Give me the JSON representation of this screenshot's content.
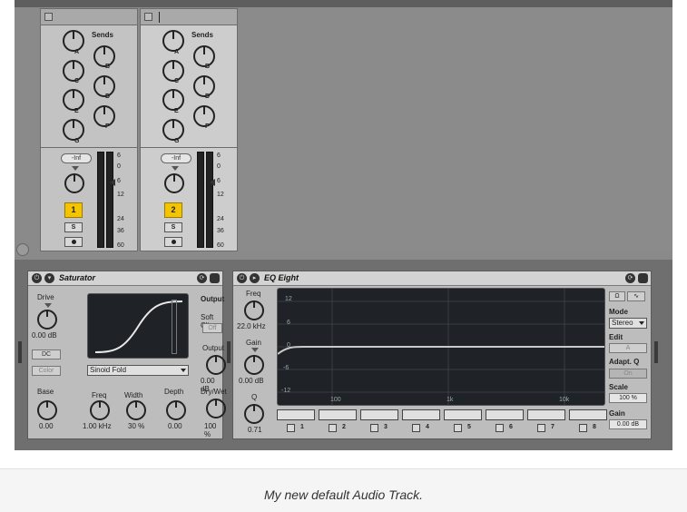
{
  "mixer": {
    "sends_label": "Sends",
    "send_letters": [
      "A",
      "B",
      "C",
      "D",
      "E",
      "F",
      "G"
    ],
    "volume_readout": "-Inf",
    "meter_scale": [
      "6",
      "0",
      "6",
      "12",
      "24",
      "36",
      "60"
    ],
    "tracks": [
      {
        "number": "1",
        "solo_label": "S"
      },
      {
        "number": "2",
        "solo_label": "S"
      }
    ]
  },
  "saturator": {
    "title": "Saturator",
    "drive_label": "Drive",
    "drive_value": "0.00 dB",
    "dc_label": "DC",
    "color_label": "Color",
    "mode_selected": "Sinoid Fold",
    "output_section": "Output",
    "soft_clip_label": "Soft Clip",
    "soft_clip_value": "Off",
    "output_label": "Output",
    "output_value": "0.00 dB",
    "drywet_label": "Dry/Wet",
    "drywet_value": "100 %",
    "base_label": "Base",
    "base_value": "0.00",
    "freq_label": "Freq",
    "freq_value": "1.00 kHz",
    "width_label": "Width",
    "width_value": "30 %",
    "depth_label": "Depth",
    "depth_value": "0.00"
  },
  "eq": {
    "title": "EQ Eight",
    "freq_label": "Freq",
    "freq_value": "22.0 kHz",
    "gain_label": "Gain",
    "gain_value": "0.00 dB",
    "q_label": "Q",
    "q_value": "0.71",
    "db_ticks": [
      "12",
      "6",
      "0",
      "-6",
      "-12"
    ],
    "freq_ticks": [
      "100",
      "1k",
      "10k"
    ],
    "bands": [
      "1",
      "2",
      "3",
      "4",
      "5",
      "6",
      "7",
      "8"
    ],
    "mode_label": "Mode",
    "mode_value": "Stereo",
    "edit_label": "Edit",
    "edit_value": "A",
    "adapt_label": "Adapt. Q",
    "adapt_value": "On",
    "scale_label": "Scale",
    "scale_value": "100 %",
    "gain_out_label": "Gain",
    "gain_out_value": "0.00 dB"
  },
  "caption": "My new default Audio Track."
}
